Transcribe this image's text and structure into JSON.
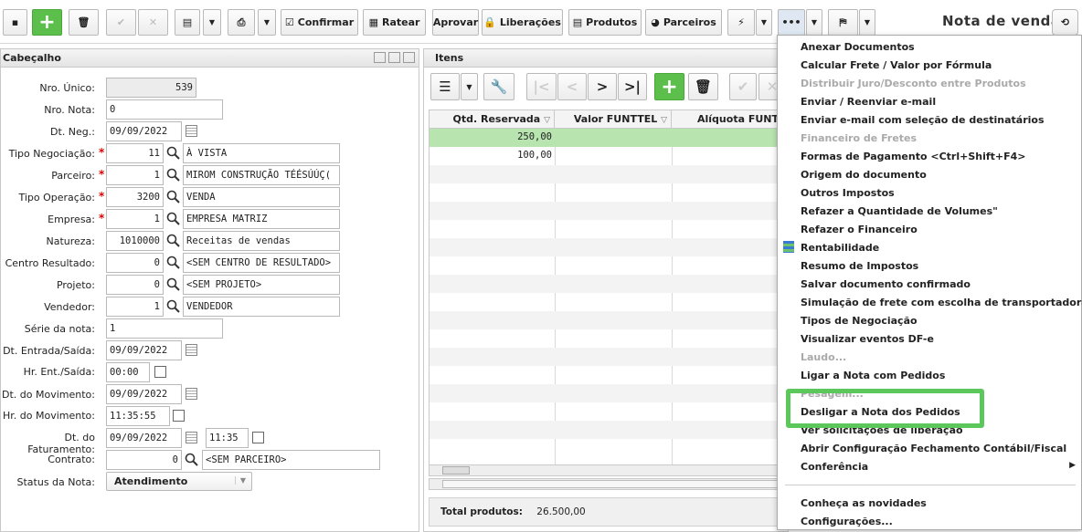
{
  "toolbar": {
    "buttons": [
      {
        "label": "Confirmar"
      },
      {
        "label": "Ratear"
      },
      {
        "label": "Aprovar"
      },
      {
        "label": "Liberações"
      },
      {
        "label": "Produtos"
      },
      {
        "label": "Parceiros"
      }
    ],
    "title": "Nota de venda"
  },
  "header": {
    "title": "Cabeçalho",
    "fields": [
      {
        "label": "Nro. Único:",
        "value": "539"
      },
      {
        "label": "Nro. Nota:",
        "value": "0"
      },
      {
        "label": "Dt. Neg.:",
        "value": "09/09/2022"
      },
      {
        "label": "Tipo Negociação:",
        "code": "11",
        "desc": "À VISTA"
      },
      {
        "label": "Parceiro:",
        "code": "1",
        "desc": "MIROM CONSTRUÇÃO TÉÉSÚÚÇ("
      },
      {
        "label": "Tipo Operação:",
        "code": "3200",
        "desc": "VENDA"
      },
      {
        "label": "Empresa:",
        "code": "1",
        "desc": "EMPRESA MATRIZ"
      },
      {
        "label": "Natureza:",
        "code": "1010000",
        "desc": "Receitas de vendas"
      },
      {
        "label": "Centro Resultado:",
        "code": "0",
        "desc": "<SEM CENTRO DE RESULTADO>"
      },
      {
        "label": "Projeto:",
        "code": "0",
        "desc": "<SEM PROJETO>"
      },
      {
        "label": "Vendedor:",
        "code": "1",
        "desc": "VENDEDOR"
      },
      {
        "label": "Série da nota:",
        "value": "1"
      },
      {
        "label": "Dt. Entrada/Saída:",
        "value": "09/09/2022"
      },
      {
        "label": "Hr. Ent./Saída:",
        "value": "00:00"
      },
      {
        "label": "Dt. do Movimento:",
        "value": "09/09/2022"
      },
      {
        "label": "Hr. do Movimento:",
        "value": "11:35:55"
      },
      {
        "label": "Dt. do Faturamento:",
        "value": "09/09/2022",
        "time": "11:35"
      },
      {
        "label": "Contrato:",
        "code": "0",
        "desc": "<SEM PARCEIRO>"
      },
      {
        "label": "Status da Nota:",
        "value": "Atendimento"
      }
    ]
  },
  "items": {
    "title": "Itens",
    "columns": [
      "Qtd. Reservada",
      "Valor FUNTTEL",
      "Alíquota FUNTT"
    ],
    "rows": [
      {
        "qtd": "250,00"
      },
      {
        "qtd": "100,00"
      }
    ],
    "total_label": "Total produtos:",
    "total_value": "26.500,00"
  },
  "menu": {
    "items": [
      {
        "label": "Anexar Documentos",
        "enabled": true
      },
      {
        "label": "Calcular Frete / Valor por Fórmula",
        "enabled": true
      },
      {
        "label": "Distribuir Juro/Desconto entre Produtos",
        "enabled": false
      },
      {
        "label": "Enviar / Reenviar e-mail",
        "enabled": true
      },
      {
        "label": "Enviar e-mail com seleção de destinatários",
        "enabled": true
      },
      {
        "label": "Financeiro de Fretes",
        "enabled": false
      },
      {
        "label": "Formas de Pagamento <Ctrl+Shift+F4>",
        "enabled": true
      },
      {
        "label": "Origem do documento",
        "enabled": true
      },
      {
        "label": "Outros Impostos",
        "enabled": true
      },
      {
        "label": "Refazer a Quantidade de Volumes\"",
        "enabled": true
      },
      {
        "label": "Refazer o Financeiro",
        "enabled": true
      },
      {
        "label": "Rentabilidade",
        "enabled": true
      },
      {
        "label": "Resumo de Impostos",
        "enabled": true
      },
      {
        "label": "Salvar documento confirmado",
        "enabled": true
      },
      {
        "label": "Simulação de frete com escolha de transportadora",
        "enabled": true
      },
      {
        "label": "Tipos de Negociação",
        "enabled": true
      },
      {
        "label": "Visualizar eventos DF-e",
        "enabled": true
      },
      {
        "label": "Laudo...",
        "enabled": false
      },
      {
        "label": "Ligar a Nota com Pedidos",
        "enabled": true
      },
      {
        "label": "Pesagem...",
        "enabled": false
      },
      {
        "label": "Desligar a Nota dos Pedidos",
        "enabled": true
      },
      {
        "label": "Ver solicitações de liberação",
        "enabled": true
      },
      {
        "label": "Abrir Configuração Fechamento Contábil/Fiscal",
        "enabled": true
      },
      {
        "label": "Conferência",
        "enabled": true
      },
      {
        "label": "Conheça as novidades",
        "enabled": true
      },
      {
        "label": "Configurações...",
        "enabled": true
      }
    ]
  }
}
